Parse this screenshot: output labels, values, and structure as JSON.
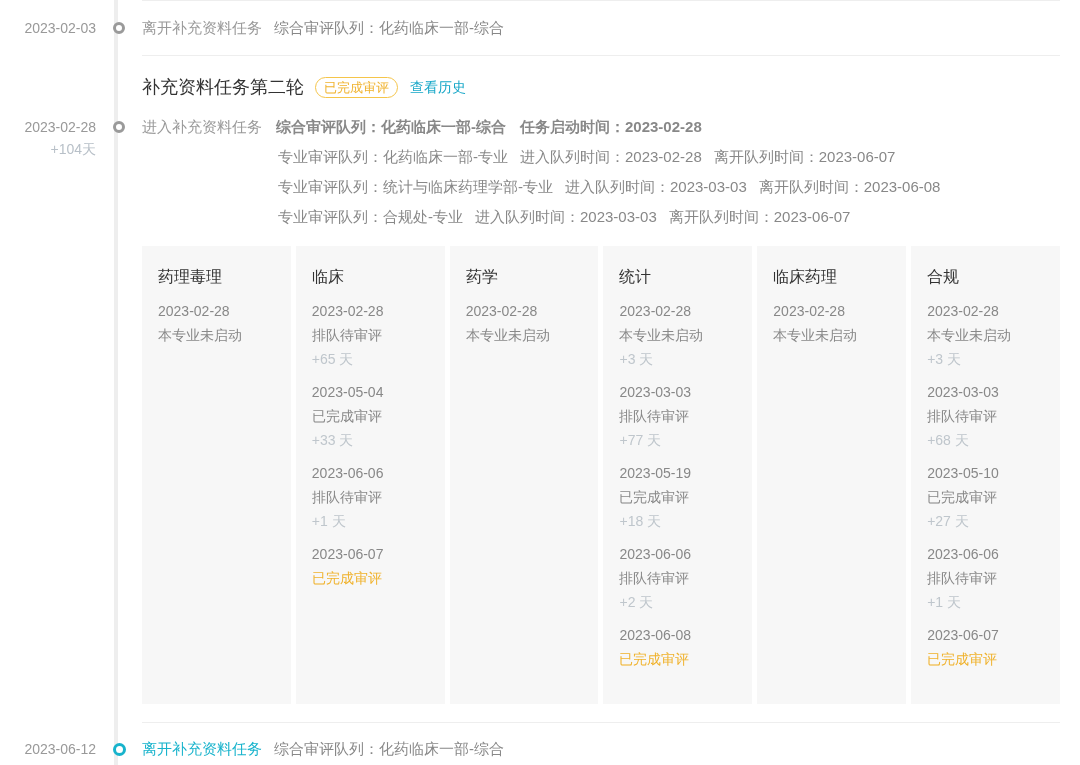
{
  "first_event": {
    "date": "2023-02-03",
    "active": false,
    "action": "离开补充资料任务",
    "queue": "综合审评队列：化药临床一部-综合"
  },
  "round": {
    "title": "补充资料任务第二轮",
    "badge": "已完成审评",
    "history_link": "查看历史"
  },
  "round_entry": {
    "date": "2023-02-28",
    "duration": "+104天",
    "active": false,
    "action": "进入补充资料任务",
    "summary": [
      "综合审评队列：化药临床一部-综合",
      "任务启动时间：2023-02-28"
    ],
    "queues": [
      [
        "专业审评队列：化药临床一部-专业",
        "进入队列时间：2023-02-28",
        "离开队列时间：2023-06-07"
      ],
      [
        "专业审评队列：统计与临床药理学部-专业",
        "进入队列时间：2023-03-03",
        "离开队列时间：2023-06-08"
      ],
      [
        "专业审评队列：合规处-专业",
        "进入队列时间：2023-03-03",
        "离开队列时间：2023-06-07"
      ]
    ]
  },
  "disciplines": [
    {
      "name": "药理毒理",
      "steps": [
        {
          "date": "2023-02-28",
          "status": "本专业未启动",
          "highlight": false
        }
      ]
    },
    {
      "name": "临床",
      "steps": [
        {
          "date": "2023-02-28",
          "status": "排队待审评",
          "highlight": false,
          "wait": "+65 天"
        },
        {
          "date": "2023-05-04",
          "status": "已完成审评",
          "highlight": false,
          "wait": "+33 天"
        },
        {
          "date": "2023-06-06",
          "status": "排队待审评",
          "highlight": false,
          "wait": "+1 天"
        },
        {
          "date": "2023-06-07",
          "status": "已完成审评",
          "highlight": true
        }
      ]
    },
    {
      "name": "药学",
      "steps": [
        {
          "date": "2023-02-28",
          "status": "本专业未启动",
          "highlight": false
        }
      ]
    },
    {
      "name": "统计",
      "steps": [
        {
          "date": "2023-02-28",
          "status": "本专业未启动",
          "highlight": false,
          "wait": "+3 天"
        },
        {
          "date": "2023-03-03",
          "status": "排队待审评",
          "highlight": false,
          "wait": "+77 天"
        },
        {
          "date": "2023-05-19",
          "status": "已完成审评",
          "highlight": false,
          "wait": "+18 天"
        },
        {
          "date": "2023-06-06",
          "status": "排队待审评",
          "highlight": false,
          "wait": "+2 天"
        },
        {
          "date": "2023-06-08",
          "status": "已完成审评",
          "highlight": true
        }
      ]
    },
    {
      "name": "临床药理",
      "steps": [
        {
          "date": "2023-02-28",
          "status": "本专业未启动",
          "highlight": false
        }
      ]
    },
    {
      "name": "合规",
      "steps": [
        {
          "date": "2023-02-28",
          "status": "本专业未启动",
          "highlight": false,
          "wait": "+3 天"
        },
        {
          "date": "2023-03-03",
          "status": "排队待审评",
          "highlight": false,
          "wait": "+68 天"
        },
        {
          "date": "2023-05-10",
          "status": "已完成审评",
          "highlight": false,
          "wait": "+27 天"
        },
        {
          "date": "2023-06-06",
          "status": "排队待审评",
          "highlight": false,
          "wait": "+1 天"
        },
        {
          "date": "2023-06-07",
          "status": "已完成审评",
          "highlight": true
        }
      ]
    }
  ],
  "last_event": {
    "date": "2023-06-12",
    "active": true,
    "action": "离开补充资料任务",
    "queue": "综合审评队列：化药临床一部-综合"
  }
}
